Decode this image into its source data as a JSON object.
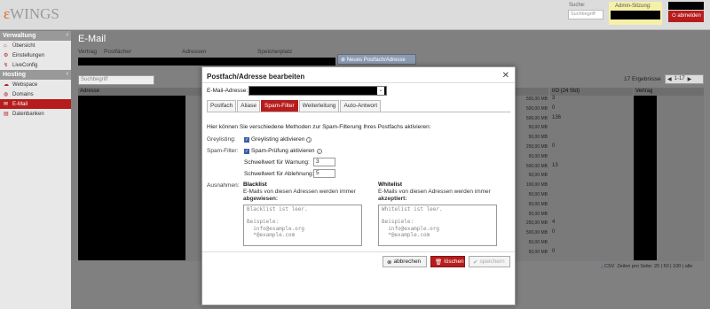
{
  "header": {
    "logo_prefix": "ε",
    "logo_text": "WINGS",
    "search_label": "Suche:",
    "search_placeholder": "Suchbegriff",
    "admin_label": "Admin-Sitzung:",
    "logout_label": "abmelden"
  },
  "sidebar": {
    "sections": [
      {
        "title": "Verwaltung",
        "items": [
          "Übersicht",
          "Einstellungen",
          "LiveConfig"
        ]
      },
      {
        "title": "Hosting",
        "items": [
          "Webspace",
          "Domains",
          "E-Mail",
          "Datenbanken"
        ]
      }
    ],
    "active_item": "E-Mail",
    "colors": {
      "active": "#b71c1c"
    }
  },
  "main": {
    "title": "E-Mail",
    "filter_labels": [
      "Vertrag",
      "Postfächer",
      "Adressen",
      "Speicherplatz"
    ],
    "new_button": "Neues Postfach/Adresse",
    "search_placeholder": "Suchbegriff",
    "result_count": "17 Ergebnisse",
    "pager_range": "1-17",
    "columns": [
      "Adresse",
      "I/O (24 Std)",
      "Vertrag"
    ],
    "rows": [
      {
        "size": "500,00 MB",
        "io": "3"
      },
      {
        "size": "500,00 MB",
        "io": "0"
      },
      {
        "size": "500,00 MB",
        "io": "136"
      },
      {
        "size": "50,00 MB",
        "io": ""
      },
      {
        "size": "50,00 MB",
        "io": ""
      },
      {
        "size": "250,00 MB",
        "io": "0"
      },
      {
        "size": "50,00 MB",
        "io": ""
      },
      {
        "size": "500,00 MB",
        "io": "13"
      },
      {
        "size": "50,00 MB",
        "io": ""
      },
      {
        "size": "100,00 MB",
        "io": ""
      },
      {
        "size": "50,00 MB",
        "io": ""
      },
      {
        "size": "50,00 MB",
        "io": ""
      },
      {
        "size": "50,00 MB",
        "io": ""
      },
      {
        "size": "250,00 MB",
        "io": "4"
      },
      {
        "size": "500,00 MB",
        "io": "0"
      },
      {
        "size": "50,00 MB",
        "io": ""
      },
      {
        "size": "50,00 MB",
        "io": "0"
      }
    ],
    "csv_label": "CSV",
    "per_page_label": "Zeilen pro Seite:",
    "per_page_options": "20 | 50 | 100 | alle"
  },
  "modal": {
    "title": "Postfach/Adresse bearbeiten",
    "email_label": "E-Mail-Adresse:",
    "tabs": [
      "Postfach",
      "Aliase",
      "Spam-Filter",
      "Weiterleitung",
      "Auto-Antwort"
    ],
    "active_tab": "Spam-Filter",
    "intro": "Hier können Sie verschiedene Methoden zur Spam-Filterung Ihres Postfachs aktivieren:",
    "greylisting_label": "Greylisting:",
    "greylisting_option": "Greylisting aktivieren",
    "spamfilter_label": "Spam-Filter:",
    "spamfilter_option": "Spam-Prüfung aktivieren",
    "warn_label": "Schwellwert für Warnung:",
    "warn_value": "3",
    "reject_label": "Schwellwert für Ablehnung:",
    "reject_value": "5",
    "exceptions_label": "Ausnahmen:",
    "blacklist": {
      "title": "Blacklist",
      "desc1": "E-Mails von diesen Adressen werden immer",
      "desc2": "abgewiesen:",
      "placeholder": "Blacklist ist leer.\n\nBeispiele:\n  info@example.org\n  *@example.com"
    },
    "whitelist": {
      "title": "Whitelist",
      "desc1": "E-Mails von diesen Adressen werden immer",
      "desc2": "akzeptiert:",
      "placeholder": "Whitelist ist leer.\n\nBeispiele:\n  info@example.org\n  *@example.com"
    },
    "cancel_label": "abbrechen",
    "delete_label": "löschen",
    "save_label": "speichern"
  }
}
